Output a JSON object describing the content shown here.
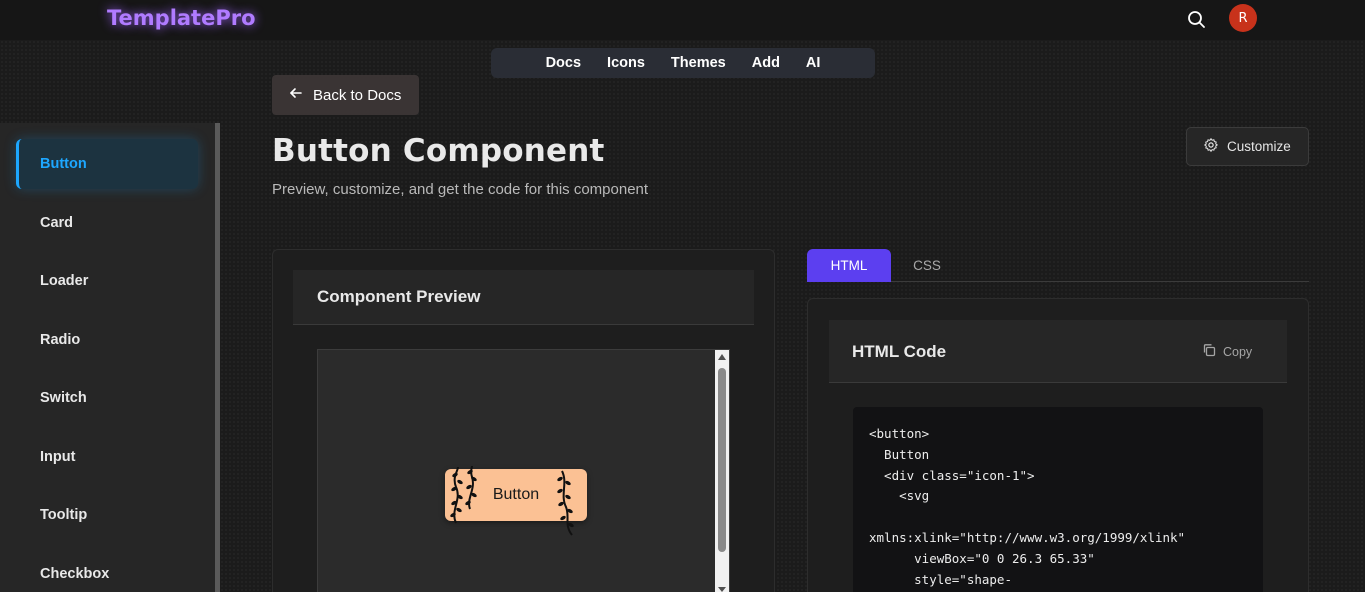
{
  "app": {
    "logo": "TemplatePro",
    "avatar_initial": "R",
    "search_icon": "search-icon",
    "colors": {
      "accent": "#5c3ff0",
      "active_sidebar": "#1da7ff",
      "avatar": "#c8321b",
      "preview_button": "#fbc194",
      "logo": "#b07bff"
    }
  },
  "nav": {
    "items": [
      "Docs",
      "Icons",
      "Themes",
      "Add",
      "AI"
    ]
  },
  "back_button": {
    "label": "Back to Docs",
    "icon": "arrow-left-icon"
  },
  "sidebar": {
    "items": [
      {
        "label": "Button",
        "active": true
      },
      {
        "label": "Card",
        "active": false
      },
      {
        "label": "Loader",
        "active": false
      },
      {
        "label": "Radio",
        "active": false
      },
      {
        "label": "Switch",
        "active": false
      },
      {
        "label": "Input",
        "active": false
      },
      {
        "label": "Tooltip",
        "active": false
      },
      {
        "label": "Checkbox",
        "active": false
      }
    ]
  },
  "header": {
    "title": "Button Component",
    "subtitle": "Preview, customize, and get the code for this component",
    "customize_label": "Customize",
    "customize_icon": "gear-icon"
  },
  "preview": {
    "title": "Component Preview",
    "button_label": "Button"
  },
  "code": {
    "tabs": [
      "HTML",
      "CSS"
    ],
    "active_tab": "HTML",
    "title": "HTML Code",
    "copy_label": "Copy",
    "copy_icon": "copy-icon",
    "content": "<button>\n  Button\n  <div class=\"icon-1\">\n    <svg\n\nxmlns:xlink=\"http://www.w3.org/1999/xlink\"\n      viewBox=\"0 0 26.3 65.33\"\n      style=\"shape-"
  }
}
